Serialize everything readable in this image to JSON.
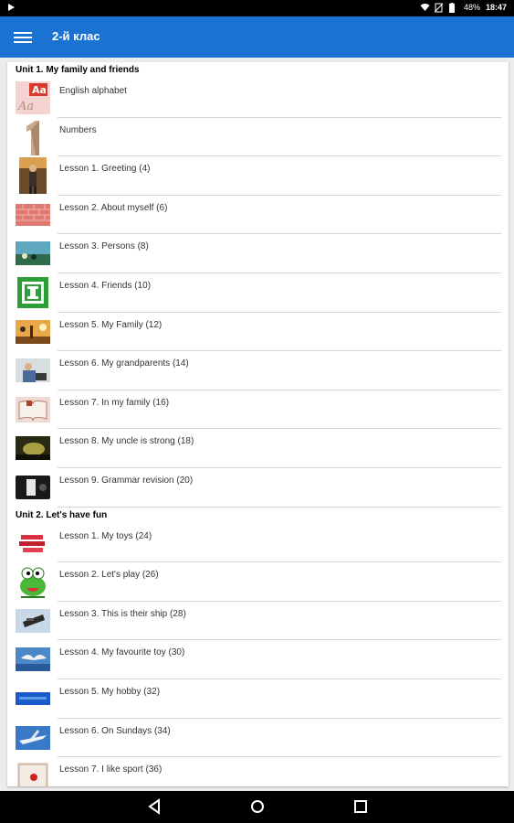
{
  "status_bar": {
    "battery": "48%",
    "time": "18:47",
    "icons": [
      "play-icon",
      "wifi-icon",
      "no-sim-icon",
      "battery-icon"
    ]
  },
  "app_bar": {
    "title": "2-й клас",
    "menu_icon": "hamburger-menu-icon",
    "color": "#1a73d1"
  },
  "units": [
    {
      "title": "Unit 1. My family and friends",
      "items": [
        {
          "label": "English alphabet",
          "icon": "alphabet-thumbnail"
        },
        {
          "label": "Numbers",
          "icon": "number-one-thumbnail"
        },
        {
          "label": "Lesson 1. Greeting (4)",
          "icon": "person-thumbnail"
        },
        {
          "label": "Lesson 2. About myself (6)",
          "icon": "brick-thumbnail"
        },
        {
          "label": "Lesson 3. Persons (8)",
          "icon": "landscape-thumbnail"
        },
        {
          "label": "Lesson 4. Friends (10)",
          "icon": "green-sign-thumbnail"
        },
        {
          "label": "Lesson 5. My Family (12)",
          "icon": "sunset-thumbnail"
        },
        {
          "label": "Lesson 6. My grandparents (14)",
          "icon": "grandparent-thumbnail"
        },
        {
          "label": "Lesson 7. In my family (16)",
          "icon": "book-thumbnail"
        },
        {
          "label": "Lesson 8. My uncle is strong (18)",
          "icon": "dark-landscape-thumbnail"
        },
        {
          "label": "Lesson 9. Grammar revision (20)",
          "icon": "device-thumbnail"
        }
      ]
    },
    {
      "title": "Unit 2. Let's have fun",
      "items": [
        {
          "label": "Lesson 1. My toys (24)",
          "icon": "toys-text-thumbnail"
        },
        {
          "label": "Lesson 2. Let's play (26)",
          "icon": "green-monster-thumbnail"
        },
        {
          "label": "Lesson 3. This is their ship (28)",
          "icon": "ship-thumbnail"
        },
        {
          "label": "Lesson 4. My favourite toy (30)",
          "icon": "seagull-thumbnail"
        },
        {
          "label": "Lesson 5. My hobby (32)",
          "icon": "blue-banner-thumbnail"
        },
        {
          "label": "Lesson 6. On Sundays (34)",
          "icon": "airplane-thumbnail"
        },
        {
          "label": "Lesson 7. I like sport (36)",
          "icon": "sport-ball-thumbnail"
        }
      ]
    }
  ],
  "nav_bar": {
    "icons": [
      "back-icon",
      "home-icon",
      "recents-icon"
    ]
  }
}
